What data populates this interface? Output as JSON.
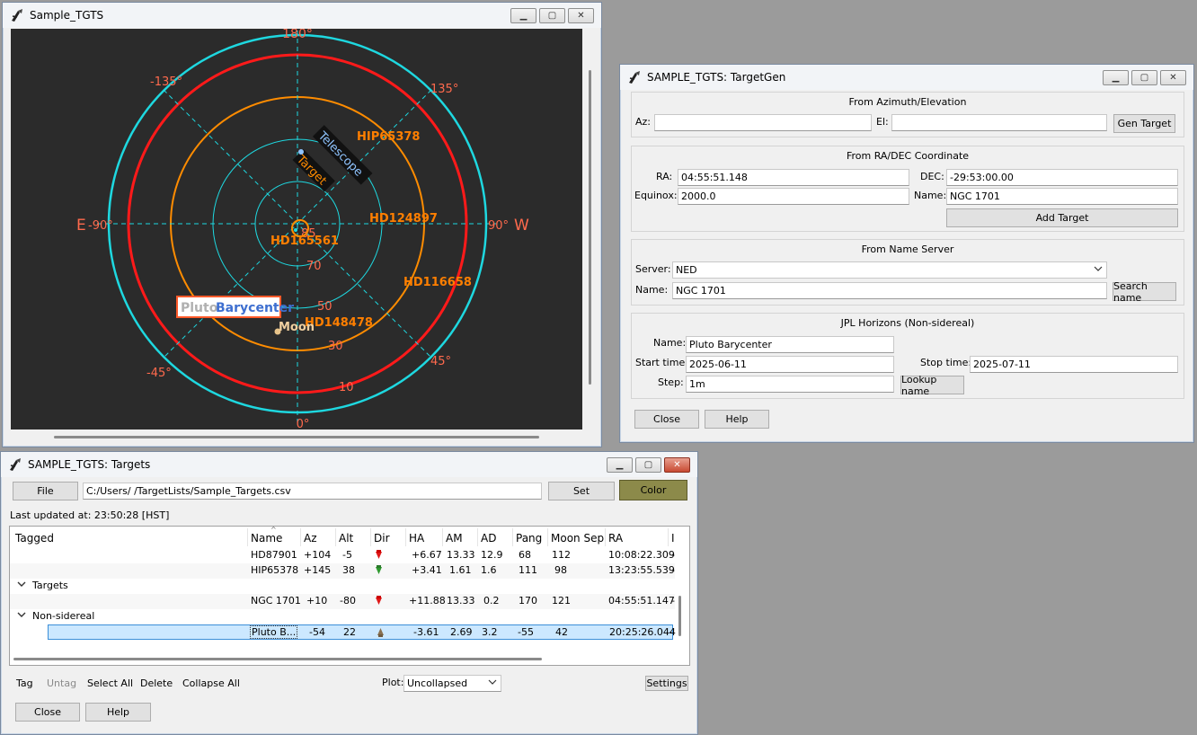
{
  "plot_window": {
    "title": "Sample_TGTS",
    "labels": {
      "n": "180°",
      "s": "0°",
      "e": "E",
      "e_deg": "-90°",
      "w": "W",
      "w_deg": "90°",
      "nw": "-135°",
      "ne": "135°",
      "sw": "-45°",
      "se": "45°"
    },
    "elevation_labels": [
      "85",
      "70",
      "50",
      "30",
      "10"
    ],
    "targets": {
      "hip65378": "HIP65378",
      "hd124897": "HD124897",
      "hd116658": "HD116658",
      "hd148478": "HD148478",
      "hd165561": "HD165561"
    },
    "telescope_label": "Telescope",
    "target_label": "Target",
    "moon_label": "Moon",
    "pluto_label_a": "Pluto",
    "pluto_label_b": "Barycenter",
    "colors": {
      "bg": "#2b2b2b",
      "cyan": "#1ed8e0",
      "red": "#ff1a1a",
      "orange": "#ff8c00",
      "label": "#ff6a4d",
      "star": "#ff7f00"
    }
  },
  "gen_window": {
    "title": "SAMPLE_TGTS: TargetGen",
    "azel": {
      "title": "From Azimuth/Elevation",
      "az_label": "Az:",
      "az_value": "",
      "el_label": "El:",
      "el_value": "",
      "button": "Gen Target"
    },
    "radec": {
      "title": "From RA/DEC Coordinate",
      "ra_label": "RA:",
      "ra_value": "04:55:51.148",
      "dec_label": "DEC:",
      "dec_value": "-29:53:00.00",
      "equinox_label": "Equinox:",
      "equinox_value": "2000.0",
      "name_label": "Name:",
      "name_value": "NGC 1701",
      "button": "Add Target"
    },
    "nameserver": {
      "title": "From Name Server",
      "server_label": "Server:",
      "server_value": "NED",
      "name_label": "Name:",
      "name_value": "NGC 1701",
      "button": "Search name"
    },
    "jpl": {
      "title": "JPL Horizons (Non-sidereal)",
      "name_label": "Name:",
      "name_value": "Pluto Barycenter",
      "start_label": "Start time:",
      "start_value": "2025-06-11",
      "stop_label": "Stop time:",
      "stop_value": "2025-07-11",
      "step_label": "Step:",
      "step_value": "1m",
      "button": "Lookup name"
    },
    "close_label": "Close",
    "help_label": "Help"
  },
  "targets_window": {
    "title": "SAMPLE_TGTS: Targets",
    "file_button": "File",
    "file_path": "C:/Users/      /TargetLists/Sample_Targets.csv",
    "set_button": "Set",
    "color_button": "Color",
    "last_updated": "Last updated at: 23:50:28 [HST]",
    "columns": [
      "Tagged",
      "Name",
      "Az",
      "Alt",
      "Dir",
      "HA",
      "AM",
      "AD",
      "Pang",
      "Moon Sep",
      "RA",
      "I"
    ],
    "rows": [
      {
        "name": "HD87901",
        "az": "+104",
        "alt": "-5",
        "ha": "+6.67",
        "am": "13.33",
        "ad": "12.9",
        "pang": "68",
        "moonsep": "112",
        "ra": "10:08:22.309",
        "trail": "-"
      },
      {
        "name": "HIP65378",
        "az": "+145",
        "alt": "38",
        "ha": "+3.41",
        "am": "1.61",
        "ad": "1.6",
        "pang": "111",
        "moonsep": "98",
        "ra": "13:23:55.539",
        "trail": "-"
      },
      {
        "name": "NGC 1701",
        "az": "+10",
        "alt": "-80",
        "ha": "+11.88",
        "am": "13.33",
        "ad": "0.2",
        "pang": "170",
        "moonsep": "121",
        "ra": "04:55:51.147",
        "trail": "-"
      },
      {
        "name": "Pluto B...",
        "az": "-54",
        "alt": "22",
        "ha": "-3.61",
        "am": "2.69",
        "ad": "3.2",
        "pang": "-55",
        "moonsep": "42",
        "ra": "20:25:26.044",
        "trail": "-"
      }
    ],
    "groups": {
      "targets": "Targets",
      "nonsidereal": "Non-sidereal"
    },
    "toolbar": {
      "tag": "Tag",
      "untag": "Untag",
      "select_all": "Select All",
      "delete": "Delete",
      "collapse_all": "Collapse All",
      "plot_label": "Plot:",
      "plot_value": "Uncollapsed",
      "settings": "Settings"
    },
    "close_label": "Close",
    "help_label": "Help"
  }
}
